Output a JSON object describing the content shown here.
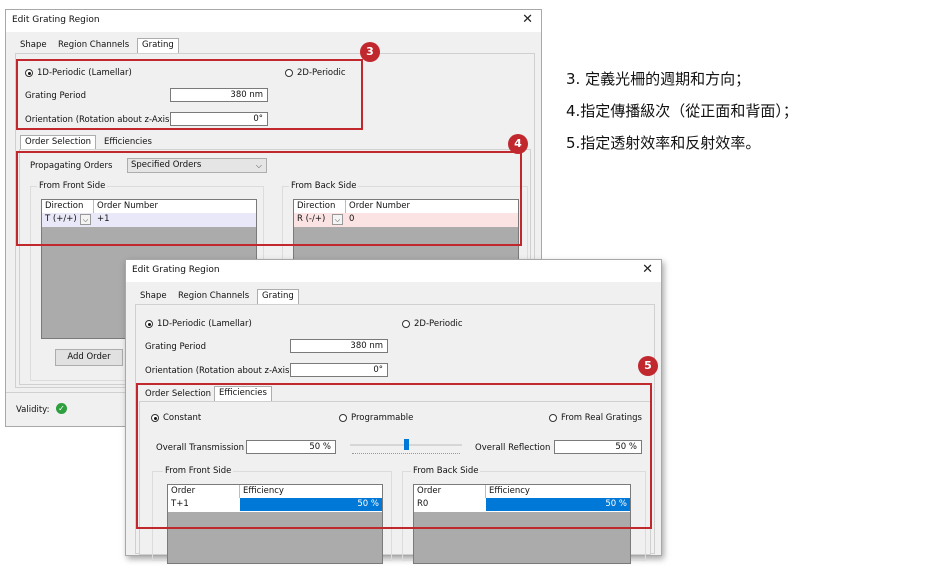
{
  "back_dialog": {
    "title": "Edit Grating Region",
    "tabs": [
      "Shape",
      "Region Channels",
      "Grating"
    ],
    "radio_1d": "1D-Periodic (Lamellar)",
    "radio_2d": "2D-Periodic",
    "grating_period_label": "Grating Period",
    "grating_period_value": "380 nm",
    "orientation_label": "Orientation (Rotation about z-Axis)",
    "orientation_value": "0°",
    "subtabs": [
      "Order Selection",
      "Efficiencies"
    ],
    "propagating_label": "Propagating Orders",
    "propagating_value": "Specified Orders",
    "front_group": "From Front Side",
    "back_group": "From Back Side",
    "front_table": {
      "headers": [
        "Direction",
        "Order Number"
      ],
      "row": [
        "T (+/+)",
        "+1"
      ]
    },
    "back_table": {
      "headers": [
        "Direction",
        "Order Number"
      ],
      "row": [
        "R (-/+)",
        "0"
      ]
    },
    "add_order_label": "Add Order",
    "validity_label": "Validity:"
  },
  "front_dialog": {
    "title": "Edit Grating Region",
    "tabs": [
      "Shape",
      "Region Channels",
      "Grating"
    ],
    "radio_1d": "1D-Periodic (Lamellar)",
    "radio_2d": "2D-Periodic",
    "grating_period_label": "Grating Period",
    "grating_period_value": "380 nm",
    "orientation_label": "Orientation (Rotation about z-Axis)",
    "orientation_value": "0°",
    "subtabs": [
      "Order Selection",
      "Efficiencies"
    ],
    "radio_constant": "Constant",
    "radio_programmable": "Programmable",
    "radio_real": "From Real Gratings",
    "transmission_label": "Overall Transmission",
    "transmission_value": "50 %",
    "reflection_label": "Overall Reflection",
    "reflection_value": "50 %",
    "slider_level": 0.5,
    "front_group": "From Front Side",
    "back_group": "From Back Side",
    "front_table": {
      "headers": [
        "Order",
        "Efficiency"
      ],
      "row": [
        "T+1",
        "50 %"
      ]
    },
    "back_table": {
      "headers": [
        "Order",
        "Efficiency"
      ],
      "row": [
        "R0",
        "50 %"
      ]
    }
  },
  "badges": [
    "3",
    "4",
    "5"
  ],
  "notes": [
    "3. 定義光柵的週期和方向；",
    "4.指定傳播級次（從正面和背面）；",
    "5.指定透射效率和反射效率。"
  ],
  "colors": {
    "highlight_red": "#c0282e",
    "selection_blue": "#0078d7",
    "row_front": "#e8e8f8",
    "row_back": "#fbe3e3",
    "valid_green": "#2e9e3e"
  }
}
